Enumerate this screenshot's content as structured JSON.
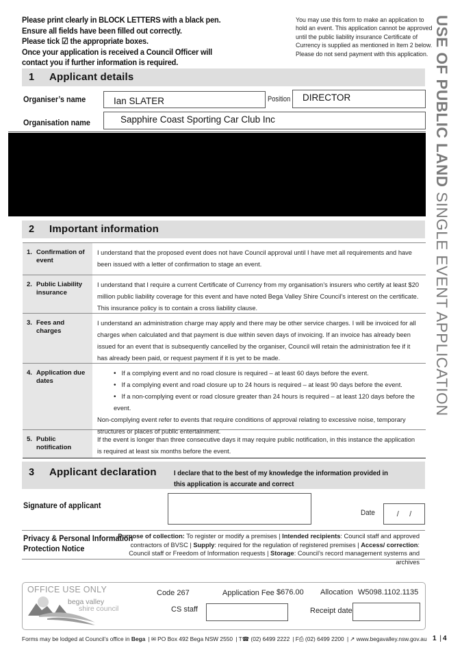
{
  "instructions": [
    "Please print clearly in BLOCK LETTERS with a black pen.",
    "Ensure all fields have been filled out correctly.",
    "Please tick ☑ the appropriate boxes.",
    "Once your application is received a Council Officer will",
    "contact you if further information is required."
  ],
  "note": [
    "You may use this form to make an application to",
    "hold an event. This application cannot be approved",
    "until the public liability insurance Certificate of",
    "Currency is supplied as mentioned in Item 2 below.",
    "Please do not send payment with this application."
  ],
  "side_title": {
    "bold": "USE OF PUBLIC LAND",
    "regular": " SINGLE EVENT APPLICATION"
  },
  "section1": {
    "number": "1",
    "title": "Applicant details",
    "organiser_label": "Organiser’s name",
    "organiser_value": "Ian SLATER",
    "position_label": "Position",
    "position_value": "DIRECTOR",
    "organisation_label": "Organisation name",
    "organisation_value": "Sapphire Coast Sporting Car Club Inc"
  },
  "section2": {
    "number": "2",
    "title": "Important information",
    "rows": [
      {
        "num": "1.",
        "key": "Confirmation of event",
        "text": "I understand that the proposed event does not have Council approval until I have met all requirements and have been issued with a letter of confirmation to stage an event."
      },
      {
        "num": "2.",
        "key": "Public Liability insurance",
        "text": "I understand that I require a current Certificate of Currency from my organisation’s insurers who certify at least $20 million public liability coverage for this event and have noted Bega Valley Shire Council’s interest on the certificate. This insurance policy is to contain a cross liability clause."
      },
      {
        "num": "3.",
        "key": "Fees and charges",
        "text": "I understand an administration charge may apply and there may be other service charges. I will be invoiced for all charges when calculated and that payment is due within seven days of invoicing. If an invoice has already been issued for an event that is subsequently cancelled by the organiser, Council will retain the administration fee if it has already been paid, or request payment if it is yet to be made."
      },
      {
        "num": "4.",
        "key": "Application due dates",
        "bullets": [
          "If a complying event and no road closure is required – at least 60 days before the event.",
          "If a complying event and road closure up to 24 hours is required – at least 90 days before the event.",
          "If a non-complying event or road closure greater than 24 hours is required – at least 120 days before the event."
        ],
        "text": "Non-complying event refer to events that require conditions of approval relating to excessive noise, temporary structures or places of public entertainment."
      },
      {
        "num": "5.",
        "key": "Public notification",
        "text": "If the event is longer than three consecutive days it may require public notification, in this instance the application is required at least six months before the event."
      }
    ]
  },
  "section3": {
    "number": "3",
    "title": "Applicant declaration",
    "declaration": "I declare that to the best of my knowledge the information provided in this application is accurate and correct",
    "signature_label": "Signature of applicant",
    "date_label": "Date",
    "date_value": "/     /"
  },
  "privacy": {
    "title_line1": "Privacy & Personal Information",
    "title_line2": "Protection Notice",
    "parts": [
      {
        "b": "Purpose of collection:",
        "t": " To register or modify a premises | "
      },
      {
        "b": "Intended recipients",
        "t": ": Council staff and approved contractors of BVSC | "
      },
      {
        "b": "Supply",
        "t": ": required for the regulation of registered premises | "
      },
      {
        "b": "Access/ correction",
        "t": ": Council staff or Freedom of Information requests | "
      },
      {
        "b": "Storage",
        "t": ": Council’s record management systems and archives"
      }
    ]
  },
  "office": {
    "title": "OFFICE USE ONLY",
    "logo_line1": "bega valley",
    "logo_line2": "shire council",
    "code": "Code 267",
    "fee_label": "Application Fee",
    "fee_value": "$676.00",
    "allocation_label": "Allocation",
    "allocation_value": "W5098.1102.1135",
    "cs_staff_label": "CS staff",
    "receipt_label": "Receipt date"
  },
  "footer": {
    "lodge_text": "Forms may be lodged at Council’s office in ",
    "lodge_place": "Bega",
    "postal": "✉ PO Box 492 Bega NSW 2550",
    "phone": "T☎ (02) 6499 2222",
    "fax": "F⎙ (02) 6499 2200",
    "web": "↗ www.begavalley.nsw.gov.au",
    "page": "1",
    "total": "4"
  }
}
